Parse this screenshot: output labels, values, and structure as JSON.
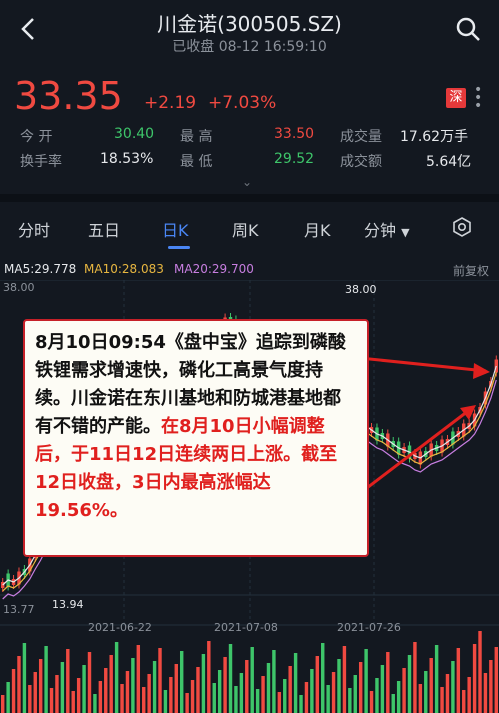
{
  "header": {
    "title": "川金诺(300505.SZ)",
    "subtitle": "已收盘 08-12 16:59:10"
  },
  "quote": {
    "price": "33.35",
    "change": "+2.19",
    "change_pct": "+7.03%",
    "exchange_tag": "深"
  },
  "stats": {
    "open_label": "今 开",
    "open_value": "30.40",
    "high_label": "最 高",
    "high_value": "33.50",
    "volume_label": "成交量",
    "volume_value": "17.62万手",
    "turnover_label": "换手率",
    "turnover_value": "18.53%",
    "low_label": "最 低",
    "low_value": "29.52",
    "amount_label": "成交额",
    "amount_value": "5.64亿"
  },
  "tabs": [
    "分时",
    "五日",
    "日K",
    "周K",
    "月K",
    "分钟"
  ],
  "active_tab": "日K",
  "ma": {
    "ma5": "MA5:29.778",
    "ma10": "MA10:28.083",
    "ma20": "MA20:29.700",
    "adjust": "前复权"
  },
  "axis": {
    "top_price": "38.00",
    "peak_label": "38.00",
    "low_price": "13.77",
    "low_mark": "13.94",
    "dates": [
      "2021-06-22",
      "2021-07-08",
      "2021-07-26"
    ]
  },
  "callout": {
    "black_text": "8月10日09:54《盘中宝》追踪到磷酸铁锂需求增速快，磷化工高景气度持续。川金诺在东川基地和防城港基地都有不错的产能。",
    "red_text": "在8月10日小幅调整后，于11日12日连续两日上涨。截至12日收盘，3日内最高涨幅达19.56%。"
  },
  "colors": {
    "up": "#f04a41",
    "down": "#3ec56a",
    "accent": "#4a86f5",
    "ma5": "#e6e8eb",
    "ma10": "#e7b640",
    "ma20": "#c77ee0"
  }
}
